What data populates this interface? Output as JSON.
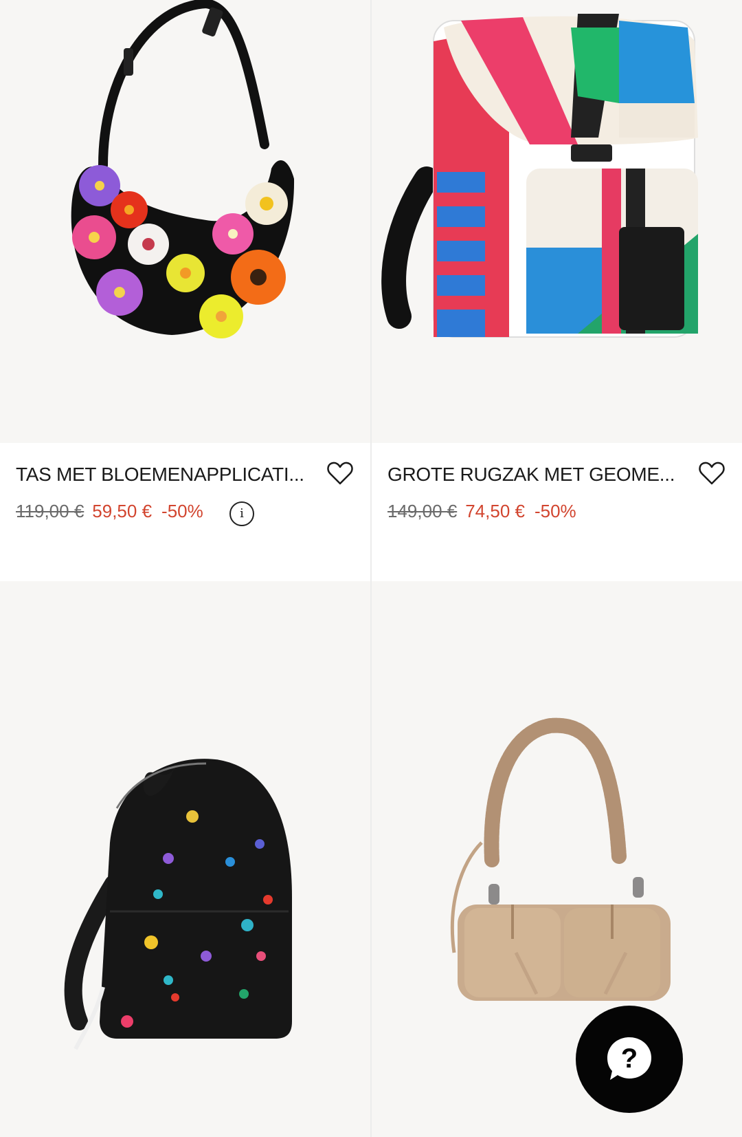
{
  "products": [
    {
      "title": "TAS MET BLOEMENAPPLICATI...",
      "old_price": "119,00 €",
      "new_price": "59,50 €",
      "discount": "-50%",
      "image": "black-half-moon-bag-with-flowers",
      "has_info": true,
      "info_label": "i"
    },
    {
      "title": "GROTE RUGZAK MET GEOME...",
      "old_price": "149,00 €",
      "new_price": "74,50 €",
      "discount": "-50%",
      "image": "geometric-print-backpack"
    },
    {
      "image": "black-floral-backpack"
    },
    {
      "image": "beige-ruched-handbag"
    }
  ],
  "help_button": {
    "label": "?",
    "icon": "help-chat-icon"
  },
  "colors": {
    "sale_red": "#d2452f",
    "image_bg": "#f7f6f4",
    "help_bg": "#050505"
  }
}
